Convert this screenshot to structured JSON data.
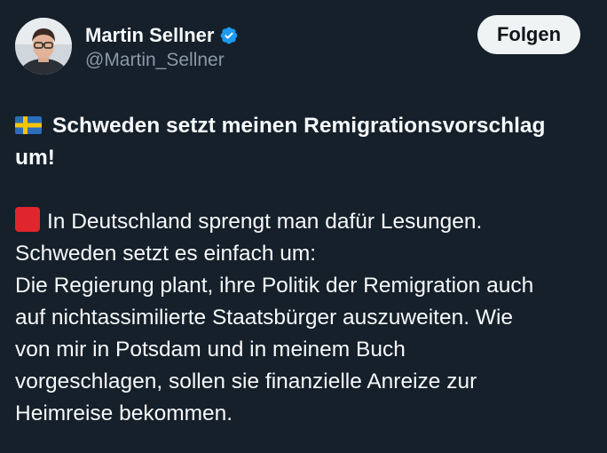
{
  "author": {
    "name": "Martin Sellner",
    "handle": "@Martin_Sellner",
    "verified": true,
    "verified_color": "#1d9bf0"
  },
  "follow_button": {
    "label": "Folgen"
  },
  "post": {
    "headline_emoji": "swedish-flag-icon",
    "headline_line1": "Schweden setzt meinen Remigrationsvorschlag",
    "headline_line2": "um!",
    "bullet_emoji": "red-square-icon",
    "lines": [
      "In Deutschland sprengt man dafür Lesungen.",
      "Schweden setzt es einfach um:",
      "Die Regierung plant, ihre Politik der Remigration auch",
      "auf nichtassimilierte Staatsbürger auszuweiten. Wie",
      "von mir in Potsdam und in meinem Buch",
      "vorgeschlagen, sollen sie finanzielle Anreize zur",
      "Heimreise bekommen."
    ]
  },
  "colors": {
    "background": "#15202b",
    "text": "#f7f9f9",
    "muted": "#8b98a5",
    "button_bg": "#eff3f4"
  }
}
